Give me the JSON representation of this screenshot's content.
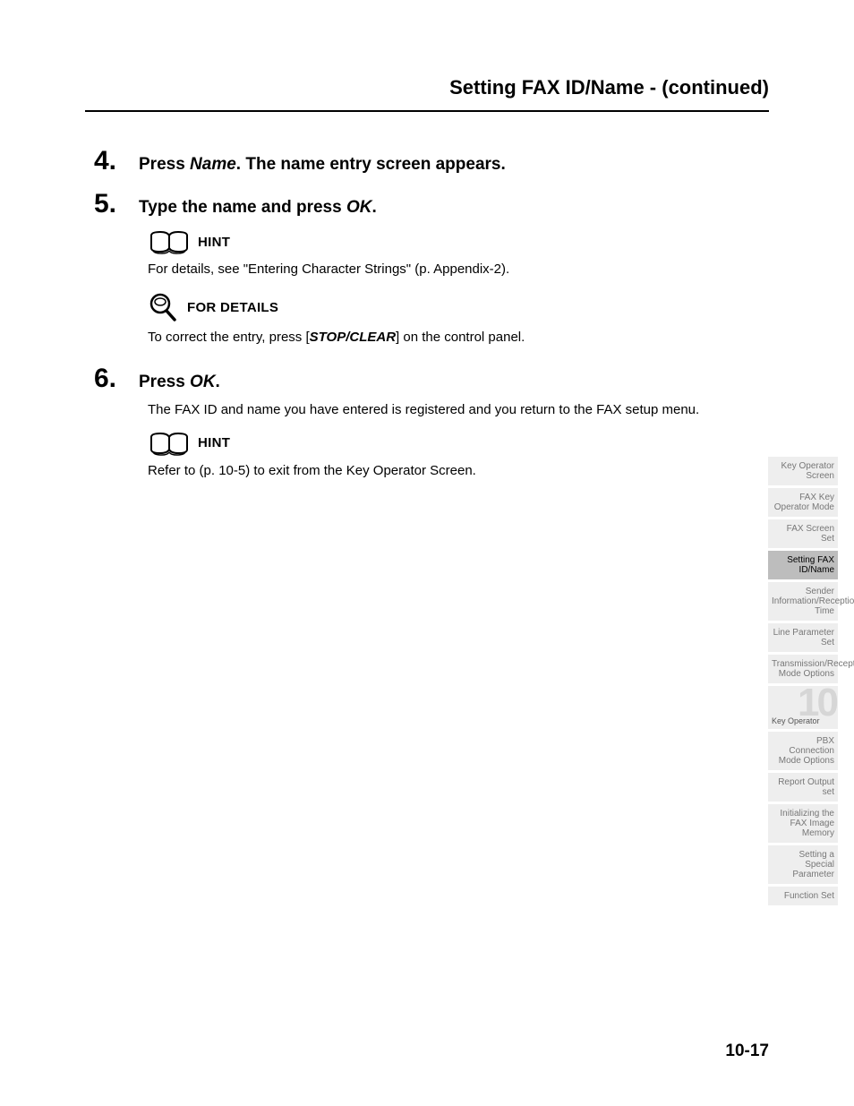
{
  "header": {
    "title": "Setting FAX ID/Name -  (continued)"
  },
  "steps": {
    "s4": {
      "num": "4.",
      "lead": "Press ",
      "em1": "Name",
      "tail": ". The name entry screen appears."
    },
    "s5": {
      "num": "5.",
      "lead": "Type the name and press ",
      "em1": "OK",
      "tail": "."
    },
    "s6": {
      "num": "6.",
      "lead": "Press ",
      "em1": "OK",
      "tail": "."
    }
  },
  "callouts": {
    "hint1": "HINT",
    "hint1_body": "For details, see \"Entering Character Strings\" (p. Appendix-2).",
    "details": "FOR DETAILS",
    "details_body_lead": "To correct the entry, press [",
    "details_body_em": "STOP/CLEAR",
    "details_body_tail": "] on the control panel.",
    "s6_body": "The FAX ID and name you have entered is registered and you return to the FAX setup menu.",
    "hint2": "HINT",
    "hint2_body": "Refer to (p. 10-5) to exit from the Key Operator Screen."
  },
  "footer": {
    "page_num": "10-17"
  },
  "sidebar": {
    "chapter_num": "10",
    "chapter_label": "Key Operator",
    "items": [
      {
        "label": "Key Operator Screen",
        "active": false
      },
      {
        "label": "FAX Key Operator Mode",
        "active": false
      },
      {
        "label": "FAX Screen Set",
        "active": false
      },
      {
        "label": "Setting FAX ID/Name",
        "active": true
      },
      {
        "label": "Sender Information/Reception Time",
        "active": false
      },
      {
        "label": "Line Parameter Set",
        "active": false
      },
      {
        "label": "Transmission/Reception Mode Options",
        "active": false
      }
    ],
    "items2": [
      {
        "label": "PBX Connection Mode Options"
      },
      {
        "label": "Report Output set"
      },
      {
        "label": "Initializing the FAX Image Memory"
      },
      {
        "label": "Setting a Special Parameter"
      },
      {
        "label": "Function Set"
      }
    ]
  }
}
